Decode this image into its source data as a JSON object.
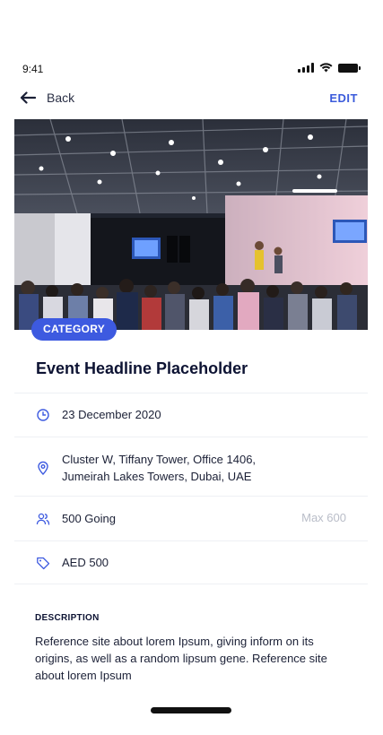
{
  "status": {
    "time": "9:41"
  },
  "nav": {
    "back_label": "Back",
    "edit_label": "EDIT"
  },
  "event": {
    "category": "CATEGORY",
    "headline": "Event Headline Placeholder",
    "date": "23 December 2020",
    "address_line1": "Cluster W, Tiffany Tower, Office 1406,",
    "address_line2": "Jumeirah Lakes Towers, Dubai, UAE",
    "going": "500 Going",
    "max": "Max 600",
    "price": "AED 500"
  },
  "description": {
    "title": "DESCRIPTION",
    "text": "Reference site about lorem Ipsum, giving inform on its origins, as well as a random lipsum gene. Reference site about lorem Ipsum"
  },
  "colors": {
    "accent": "#3d5ae0",
    "edit": "#3b5bdb",
    "muted": "#b9bdc8"
  }
}
